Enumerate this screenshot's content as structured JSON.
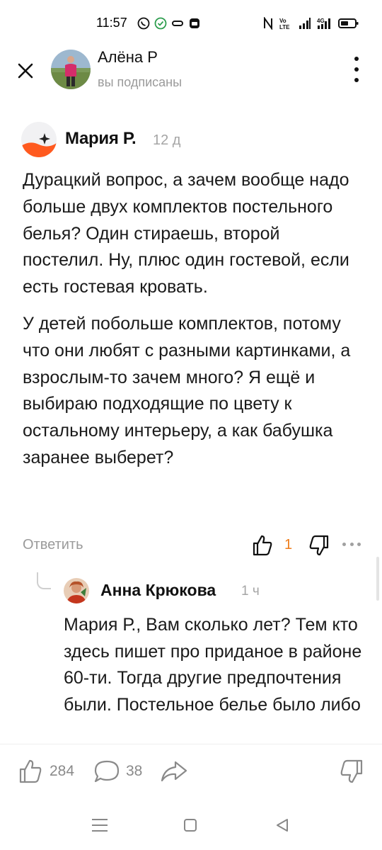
{
  "status_bar": {
    "time": "11:57",
    "left_icons": [
      "whatsapp-icon",
      "check-circle-icon",
      "link-icon",
      "notification-icon"
    ],
    "right_icons": [
      "nfc-icon",
      "volte-icon",
      "signal-icon",
      "4g-signal-icon",
      "battery-icon"
    ],
    "volte_label": "Vo\nLTE",
    "network_label": "4G"
  },
  "header": {
    "name": "Алёна Р",
    "subtitle": "вы подписаны"
  },
  "comment": {
    "author": "Мария Р.",
    "time": "12 д",
    "paragraphs": [
      "Дурацкий вопрос, а зачем вообще надо больше двух комплектов постельного белья? Один стираешь, второй постелил. Ну, плюс один гостевой, если есть гостевая кровать.",
      "У детей побольше комплектов, потому что они любят с разными картинками, а взрослым-то зачем много? Я ещё и выбираю подходящие по цвету к остальному интерьеру, а как бабушка заранее выберет?"
    ],
    "reply_label": "Ответить",
    "likes": "1"
  },
  "reply": {
    "author": "Анна Крюкова",
    "time": "1 ч",
    "text": "Мария Р., Вам сколько лет? Тем кто здесь пишет про приданое в районе 60-ти. Тогда другие предпочтения были. Постельное белье было либо"
  },
  "bottom_bar": {
    "likes": "284",
    "comments": "38"
  },
  "colors": {
    "accent": "#ee7c1a",
    "muted": "#9a9a9a"
  }
}
